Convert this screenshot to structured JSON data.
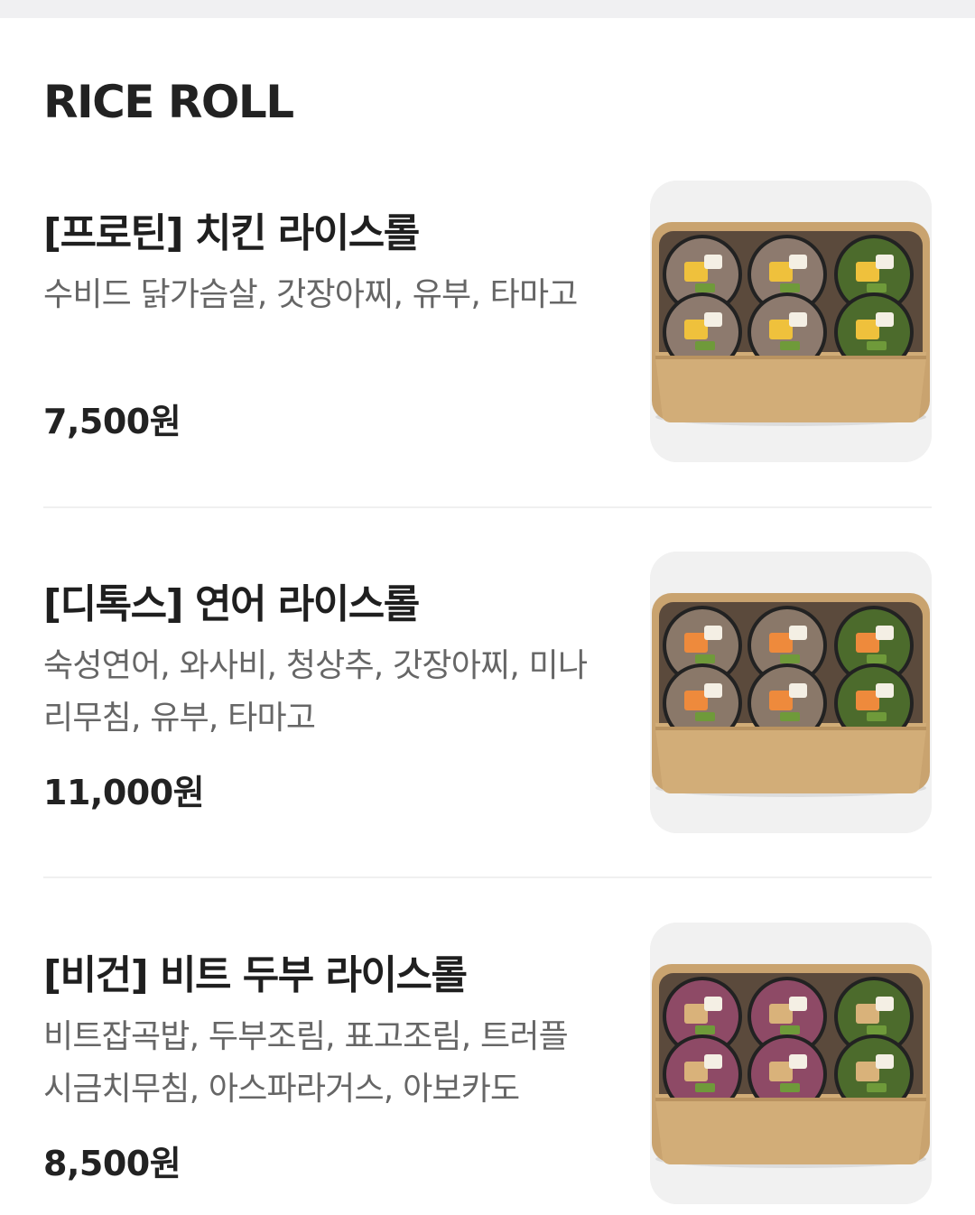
{
  "section": {
    "title": "RICE ROLL"
  },
  "items": [
    {
      "name": "[프로틴] 치킨 라이스롤",
      "description": "수비드 닭가슴살, 갓장아찌, 유부, 타마고",
      "price": "7,500원",
      "image_icon": "chicken-rice-roll-photo",
      "rice_color": "#8d7a6e",
      "filling_color": "#efc13c"
    },
    {
      "name": "[디톡스] 연어 라이스롤",
      "description": "숙성연어, 와사비, 청상추, 갓장아찌, 미나리무침, 유부, 타마고",
      "price": "11,000원",
      "image_icon": "salmon-rice-roll-photo",
      "rice_color": "#8a7869",
      "filling_color": "#ee8a3c"
    },
    {
      "name": "[비건] 비트 두부 라이스롤",
      "description": "비트잡곡밥, 두부조림, 표고조림, 트러플 시금치무침, 아스파라거스, 아보카도",
      "price": "8,500원",
      "image_icon": "beet-tofu-rice-roll-photo",
      "rice_color": "#8e4a66",
      "filling_color": "#d9b27a"
    }
  ]
}
